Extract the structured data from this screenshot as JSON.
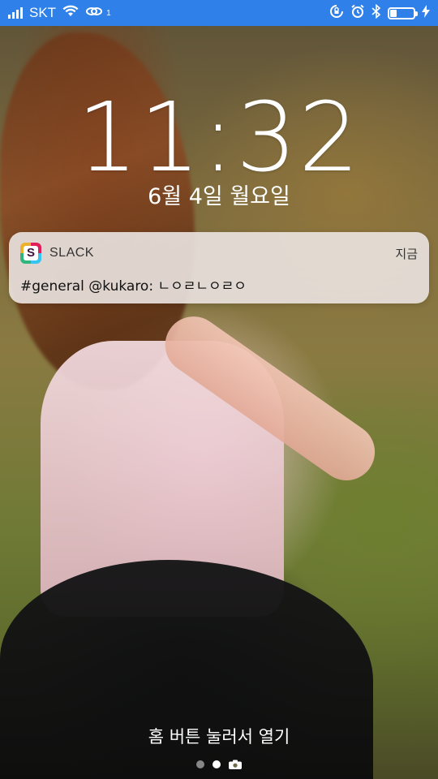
{
  "status_bar": {
    "carrier": "SKT",
    "hotspot_badge": "1",
    "background_color": "#2f80e8",
    "battery_level_fraction": 0.3,
    "icons": [
      "signal-bars-icon",
      "wifi-icon",
      "hotspot-link-icon",
      "rotation-lock-icon",
      "alarm-icon",
      "bluetooth-icon",
      "battery-icon",
      "charging-bolt-icon"
    ]
  },
  "lock_screen": {
    "time": "11:32",
    "date": "6월 4일 월요일",
    "unlock_hint": "홈 버튼 눌러서 열기",
    "page_indicator": {
      "count": 2,
      "active_index": 1,
      "camera_icon": "camera-icon"
    }
  },
  "notification": {
    "app_name": "SLACK",
    "app_icon": "slack-app-icon",
    "app_icon_letter": "S",
    "time": "지금",
    "message": "#general @kukaro: ㄴㅇㄹㄴㅇㄹㅇ"
  }
}
